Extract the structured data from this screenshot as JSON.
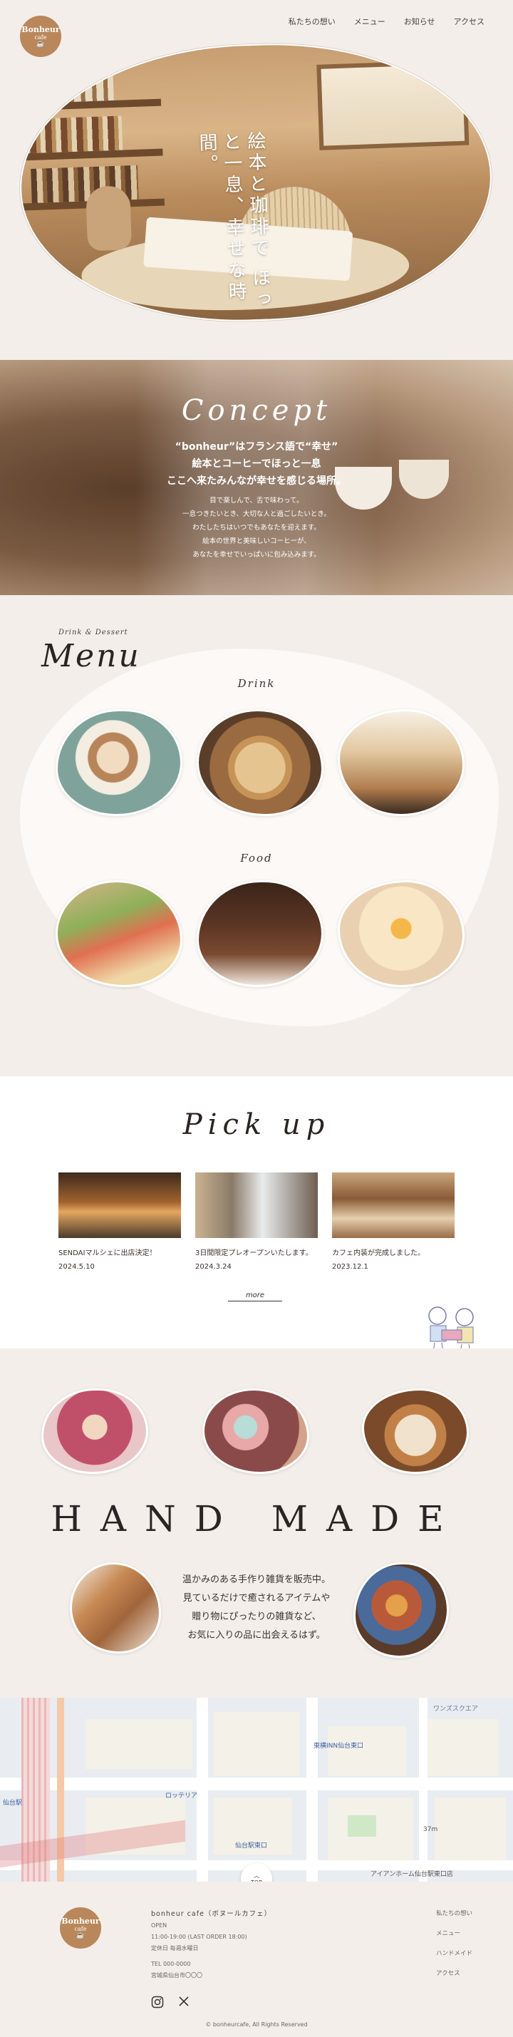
{
  "brand": {
    "line1": "Bonheur",
    "line2": "cafe"
  },
  "nav": [
    "私たちの想い",
    "メニュー",
    "お知らせ",
    "アクセス"
  ],
  "hero": {
    "text": "絵本と珈琲で ほっと一息、幸せな時間。"
  },
  "concept": {
    "title": "Concept",
    "lead": [
      "“bonheur”はフランス語で“幸せ”",
      "絵本とコーヒーでほっと一息",
      "ここへ来たみんなが幸せを感じる場所。"
    ],
    "body": [
      "目で楽しんで、舌で味わって。",
      "一息つきたいとき、大切な人と過ごしたいとき。",
      "わたしたちはいつでもあなたを迎えます。",
      "絵本の世界と美味しいコーヒーが、",
      "あなたを幸せでいっぱいに包み込みます。"
    ]
  },
  "menu": {
    "sub": "Drink & Dessert",
    "title": "Menu",
    "drink": "Drink",
    "food": "Food"
  },
  "pickup": {
    "title": "Pick up",
    "items": [
      {
        "title": "SENDAIマルシェに出店決定！",
        "date": "2024.5.10"
      },
      {
        "title": "3日間限定プレオープンいたします。",
        "date": "2024.3.24"
      },
      {
        "title": "カフェ内装が完成しました。",
        "date": "2023.12.1"
      }
    ],
    "more": "more"
  },
  "handmade": {
    "title": "HAND MADE",
    "text": [
      "温かみのある手作り雑貨を販売中。",
      "見ているだけで癒されるアイテムや",
      "贈り物にぴったりの雑貨など、",
      "お気に入りの品に出会えるはず。"
    ]
  },
  "map": {
    "labels": [
      "仙台駅",
      "ロッテリア",
      "東横INN仙台東口",
      "37m",
      "仙台駅東口",
      "ワンズスクエア",
      "アイアンホーム仙台駅東口店"
    ],
    "top_label": "TOP"
  },
  "footer": {
    "name": "bonheur cafe（ボヌールカフェ）",
    "open_label": "OPEN",
    "hours": "11:00-19:00 (LAST ORDER 18:00)",
    "closed": "定休日 毎週水曜日",
    "tel": "TEL 000-0000",
    "address": "宮城県仙台市〇〇〇",
    "links": [
      "私たちの想い",
      "メニュー",
      "ハンドメイド",
      "アクセス"
    ],
    "copyright": "© bonheurcafe, All Rights Reserved"
  },
  "colors": {
    "accent": "#b9875a",
    "bg": "#f3eeea",
    "text": "#3a3230"
  }
}
